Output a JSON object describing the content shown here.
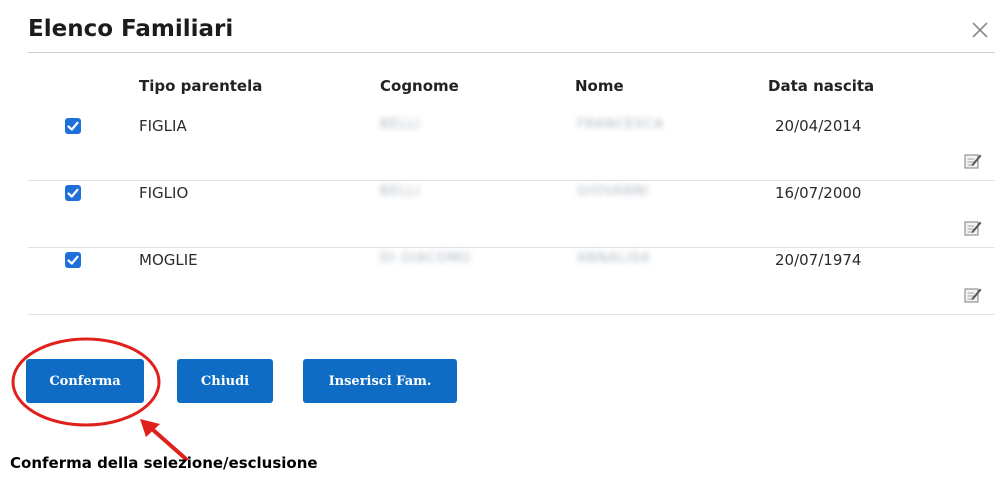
{
  "dialog": {
    "title": "Elenco Familiari"
  },
  "table": {
    "headers": {
      "relation": "Tipo parentela",
      "surname": "Cognome",
      "name": "Nome",
      "birthdate": "Data nascita"
    },
    "rows": [
      {
        "checked": true,
        "relation": "FIGLIA",
        "surname": "BELLI",
        "name": "FRANCESCA",
        "birthdate": "20/04/2014"
      },
      {
        "checked": true,
        "relation": "FIGLIO",
        "surname": "BELLI",
        "name": "GIOVANNI",
        "birthdate": "16/07/2000"
      },
      {
        "checked": true,
        "relation": "MOGLIE",
        "surname": "DI GIACOMO",
        "name": "ANNALISA",
        "birthdate": "20/07/1974"
      }
    ]
  },
  "buttons": {
    "confirm": "Conferma",
    "close": "Chiudi",
    "insert": "Inserisci Fam."
  },
  "annotation": {
    "text": "Conferma della selezione/esclusione",
    "color": "#e0201b"
  },
  "colors": {
    "accent": "#0f6cc4",
    "checkbox": "#1e6fd9"
  }
}
